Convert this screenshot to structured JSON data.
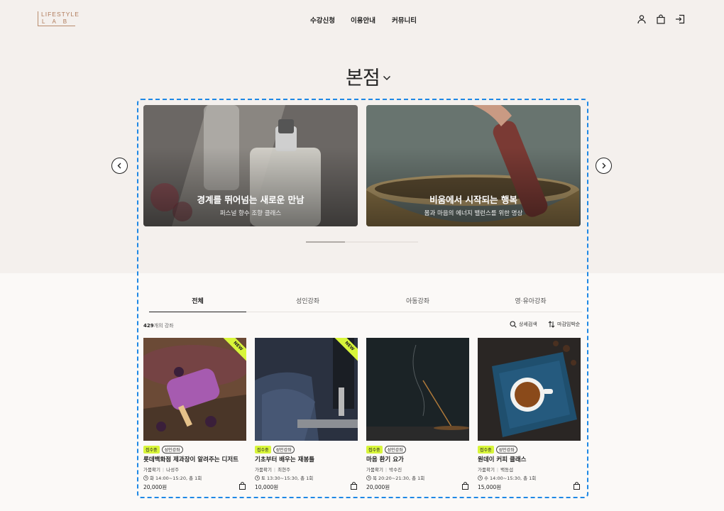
{
  "header": {
    "logo_top": "LIFESTYLE",
    "logo_bottom": "LAB",
    "nav": [
      "수강신청",
      "이용안내",
      "커뮤니티"
    ],
    "icons": [
      "user-icon",
      "bag-icon",
      "login-icon"
    ]
  },
  "branch": {
    "title": "본점"
  },
  "banners": [
    {
      "title": "경계를 뛰어넘는 새로운 만남",
      "subtitle": "퍼스널 향수 조향 클래스"
    },
    {
      "title": "비움에서 시작되는 행복",
      "subtitle": "몸과 마음의 에너지 밸런스를 위한 명상"
    }
  ],
  "carousel": {
    "progress": 0.35
  },
  "tabs": [
    "전체",
    "성인강좌",
    "아동강좌",
    "영·유아강좌"
  ],
  "list": {
    "count": "429",
    "count_suffix": "개의 강좌",
    "detail_search": "상세검색",
    "sort": "마감임박순"
  },
  "cards": [
    {
      "badge1": "접수중",
      "badge2": "성인강좌",
      "title": "롯데백화점 제과장이 알려주는 디저트",
      "category": "가뭄확기",
      "teacher": "나성주",
      "schedule": "화 14:00~15:20, 총 1회",
      "price": "20,000원",
      "is_new": true
    },
    {
      "badge1": "접수중",
      "badge2": "성인강좌",
      "title": "기초부터 배우는 재봉틀",
      "category": "가뭄확기",
      "teacher": "최현주",
      "schedule": "토 13:30~15:30, 총 1회",
      "price": "10,000원",
      "is_new": true
    },
    {
      "badge1": "접수중",
      "badge2": "성인강좌",
      "title": "마음 환기 요가",
      "category": "가뭄확기",
      "teacher": "박수진",
      "schedule": "목 20:20~21:30, 총 1회",
      "price": "20,000원",
      "is_new": false
    },
    {
      "badge1": "접수중",
      "badge2": "성인강좌",
      "title": "원데이 커피 클래스",
      "category": "가뭄확기",
      "teacher": "백동섭",
      "schedule": "수 14:00~15:30, 총 1회",
      "price": "15,000원",
      "is_new": false
    }
  ],
  "ribbon_label": "NEW"
}
